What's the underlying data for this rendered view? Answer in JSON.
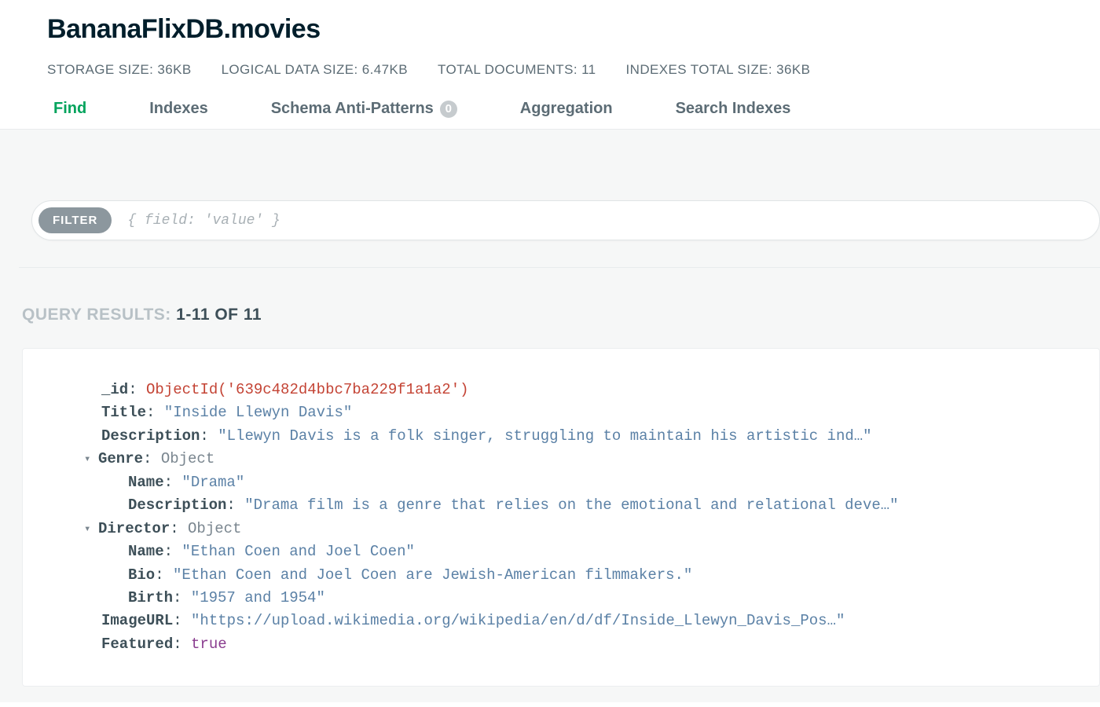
{
  "header": {
    "title": "BananaFlixDB.movies",
    "stats": [
      {
        "label": "STORAGE SIZE:",
        "value": "36KB"
      },
      {
        "label": "LOGICAL DATA SIZE:",
        "value": "6.47KB"
      },
      {
        "label": "TOTAL DOCUMENTS:",
        "value": "11"
      },
      {
        "label": "INDEXES TOTAL SIZE:",
        "value": "36KB"
      }
    ]
  },
  "tabs": {
    "find": "Find",
    "indexes": "Indexes",
    "schema": "Schema Anti-Patterns",
    "schema_badge": "0",
    "aggregation": "Aggregation",
    "search": "Search Indexes"
  },
  "filter": {
    "pill": "FILTER",
    "placeholder": "{ field: 'value' }"
  },
  "results": {
    "label": "QUERY RESULTS: ",
    "range": "1-11 OF 11"
  },
  "doc": {
    "id_key": "_id",
    "id_val": "ObjectId('639c482d4bbc7ba229f1a1a2')",
    "title_key": "Title",
    "title_val": "\"Inside Llewyn Davis\"",
    "desc_key": "Description",
    "desc_val": "\"Llewyn Davis is a folk singer, struggling to maintain his artistic ind…\"",
    "genre_key": "Genre",
    "object_label": "Object",
    "genre_name_key": "Name",
    "genre_name_val": "\"Drama\"",
    "genre_desc_key": "Description",
    "genre_desc_val": "\"Drama film is a genre that relies on the emotional and relational deve…\"",
    "director_key": "Director",
    "director_name_key": "Name",
    "director_name_val": "\"Ethan Coen and Joel Coen\"",
    "director_bio_key": "Bio",
    "director_bio_val": "\"Ethan Coen and Joel Coen are Jewish-American filmmakers.\"",
    "director_birth_key": "Birth",
    "director_birth_val": "\"1957 and 1954\"",
    "image_key": "ImageURL",
    "image_val": "\"https://upload.wikimedia.org/wikipedia/en/d/df/Inside_Llewyn_Davis_Pos…\"",
    "featured_key": "Featured",
    "featured_val": "true"
  }
}
